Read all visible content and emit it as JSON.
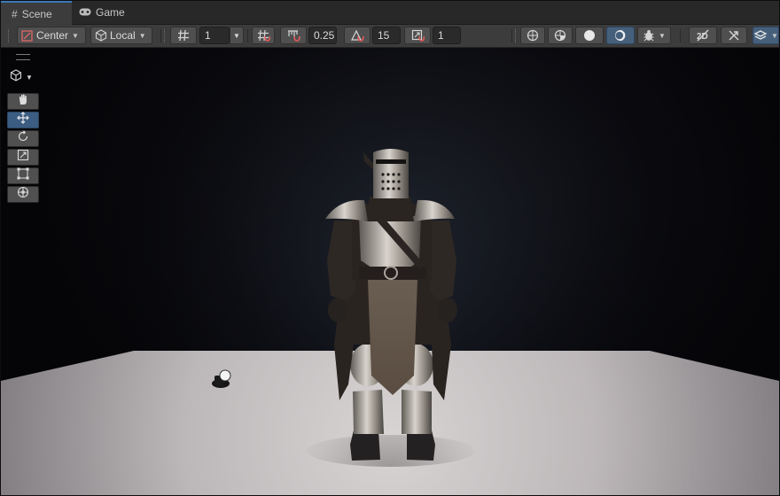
{
  "tabs": [
    {
      "label": "Scene",
      "icon": "hash-grid-icon",
      "active": true
    },
    {
      "label": "Game",
      "icon": "gamepad-icon",
      "active": false
    }
  ],
  "toolbar": {
    "pivot_label": "Center",
    "handle_label": "Local",
    "grid_size_value": "1",
    "snap_move_value": "0.25",
    "snap_rotate_value": "15",
    "snap_scale_value": "1"
  },
  "view_tools": [
    {
      "name": "hand-tool",
      "icon": "hand-icon",
      "active": false
    },
    {
      "name": "move-tool",
      "icon": "move-arrows-icon",
      "active": true
    },
    {
      "name": "rotate-tool",
      "icon": "rotate-icon",
      "active": false
    },
    {
      "name": "scale-tool",
      "icon": "scale-icon",
      "active": false
    },
    {
      "name": "rect-tool",
      "icon": "rect-icon",
      "active": false
    },
    {
      "name": "transform-tool",
      "icon": "transform-icon",
      "active": false
    }
  ],
  "colors": {
    "accent": "#3a79bb",
    "active_tool": "#3c5d82",
    "toolbar_bg": "#3c3c3c",
    "floor": "#c9c4c4"
  }
}
